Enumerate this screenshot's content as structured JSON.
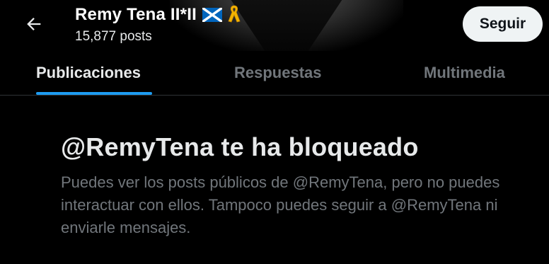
{
  "header": {
    "back_icon": "arrow-left-icon",
    "display_name": "Remy Tena II*II",
    "flag_icon": "scotland-flag-icon",
    "ribbon_icon": "yellow-ribbon-icon",
    "post_count": "15,877 posts",
    "follow_label": "Seguir"
  },
  "tabs": [
    {
      "label": "Publicaciones",
      "active": true
    },
    {
      "label": "Respuestas",
      "active": false
    },
    {
      "label": "Multimedia",
      "active": false
    }
  ],
  "blocked": {
    "title": "@RemyTena te ha bloqueado",
    "description": "Puedes ver los posts públicos de @RemyTena, pero no puedes interactuar con ellos. Tampoco puedes seguir a @RemyTena ni enviarle mensajes."
  },
  "colors": {
    "background": "#000000",
    "accent": "#1d9bf0",
    "text_primary": "#e7e9ea",
    "text_secondary": "#71767b",
    "divider": "#2f3336",
    "button_bg": "#eff3f4"
  }
}
